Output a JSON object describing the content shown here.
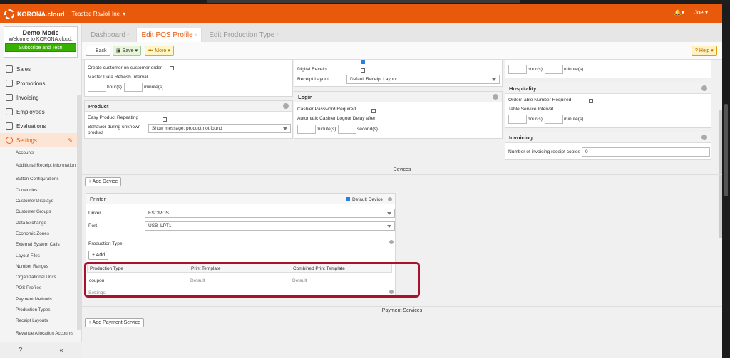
{
  "header": {
    "brand": "KORONA.cloud",
    "company": "Toasted Ravioli Inc. ▾",
    "bell": "🔔▾",
    "user": "Joe ▾"
  },
  "demo": {
    "title": "Demo Mode",
    "subtitle": "Welcome to KORONA.cloud.",
    "button": "Subscribe and Test!"
  },
  "nav": {
    "items": [
      "Sales",
      "Promotions",
      "Invoicing",
      "Employees",
      "Evaluations",
      "Settings"
    ],
    "subs": [
      "Accounts",
      "Additional Receipt Information",
      "Button Configurations",
      "Currencies",
      "Customer Displays",
      "Customer Groups",
      "Data Exchange",
      "Economic Zones",
      "External System Calls",
      "Layout Files",
      "Number Ranges",
      "Organizational Units",
      "POS Profiles",
      "Payment Methods",
      "Production Types",
      "Receipt Layouts",
      "Revenue Allocation Accounts"
    ]
  },
  "tabs": [
    "Dashboard",
    "Edit POS Profile",
    "Edit Production Type"
  ],
  "toolbar": {
    "back": "Back",
    "save": "Save ▾",
    "more": "••• More ▾",
    "help": "Help ▾"
  },
  "left_top": {
    "l1": "Create customer on customer order",
    "l2": "Master Data Refresh Interval",
    "hours": "hour(s)",
    "minutes": "minute(s)"
  },
  "product": {
    "title": "Product",
    "l1": "Easy Product Repeating",
    "l2": "Behavior during unknown product",
    "value": "Show message: product not found"
  },
  "mid_top": {
    "l1": "Digital Receipt",
    "l2": "Receipt Layout",
    "value": "Default Receipt Layout"
  },
  "login": {
    "title": "Login",
    "l1": "Cashier Password Required",
    "l2": "Automatic Cashier Logout Delay after",
    "minutes": "minute(s)",
    "seconds": "second(s)"
  },
  "right_top": {
    "hours": "hour(s)",
    "minutes": "minute(s)"
  },
  "hospitality": {
    "title": "Hospitality",
    "l1": "Order/Table Number Required",
    "l2": "Table Service Interval",
    "hours": "hour(s)",
    "minutes": "minute(s)"
  },
  "invoicing": {
    "title": "Invoicing",
    "l1": "Number of invoicing receipt copies",
    "value": "0"
  },
  "devices": {
    "title": "Devices",
    "add": "+ Add Device",
    "printer": "Printer",
    "default": "Default Device",
    "driver_label": "Driver",
    "driver": "ESC/POS",
    "port_label": "Port",
    "port": "USB_LPT1",
    "prod_type": "Production Type",
    "add_small": "+ Add",
    "cols": [
      "Production Type",
      "Print Template",
      "Combined Print Template"
    ],
    "row": [
      "coupon",
      "Default",
      "Default"
    ],
    "settings": "Settings"
  },
  "payment": {
    "title": "Payment Services",
    "add": "+ Add Payment Service"
  },
  "colors": {
    "accent": "#e8590c",
    "highlight": "#a8122e"
  }
}
